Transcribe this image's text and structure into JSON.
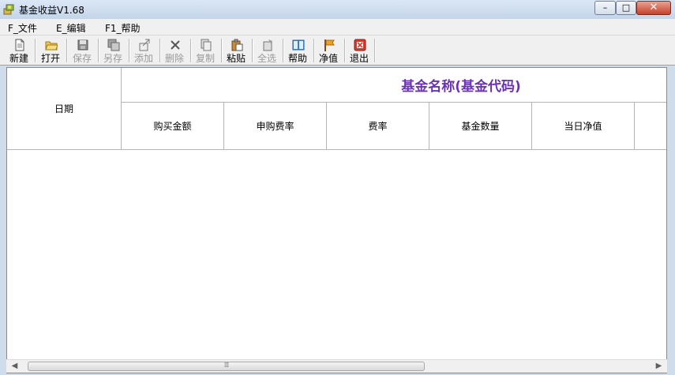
{
  "window": {
    "title": "基金收益V1.68",
    "controls": {
      "minimize": "–",
      "maximize": "□",
      "close": "✕"
    }
  },
  "menu": [
    "F_文件",
    "E_编辑",
    "F1_帮助"
  ],
  "toolbar": [
    {
      "label": "新建",
      "icon": "new-document-icon",
      "enabled": true
    },
    {
      "label": "打开",
      "icon": "open-folder-icon",
      "enabled": true
    },
    {
      "label": "保存",
      "icon": "save-disk-icon",
      "enabled": false
    },
    {
      "label": "另存",
      "icon": "save-as-icon",
      "enabled": false
    },
    {
      "label": "添加",
      "icon": "add-icon",
      "enabled": false
    },
    {
      "label": "删除",
      "icon": "delete-x-icon",
      "enabled": false
    },
    {
      "label": "复制",
      "icon": "copy-icon",
      "enabled": false
    },
    {
      "label": "粘贴",
      "icon": "paste-icon",
      "enabled": true
    },
    {
      "label": "全选",
      "icon": "select-all-icon",
      "enabled": false
    },
    {
      "label": "帮助",
      "icon": "help-book-icon",
      "enabled": true
    },
    {
      "label": "净值",
      "icon": "flag-icon",
      "enabled": true
    },
    {
      "label": "退出",
      "icon": "exit-icon",
      "enabled": true
    }
  ],
  "grid": {
    "fund_header": "基金名称(基金代码)",
    "date_header": "日期",
    "columns": [
      "购买金额",
      "申购费率",
      "费率",
      "基金数量",
      "当日净值"
    ]
  },
  "scrollbar": {
    "grip": "⁞⁞⁞"
  },
  "colors": {
    "header_accent": "#6b32b8"
  }
}
